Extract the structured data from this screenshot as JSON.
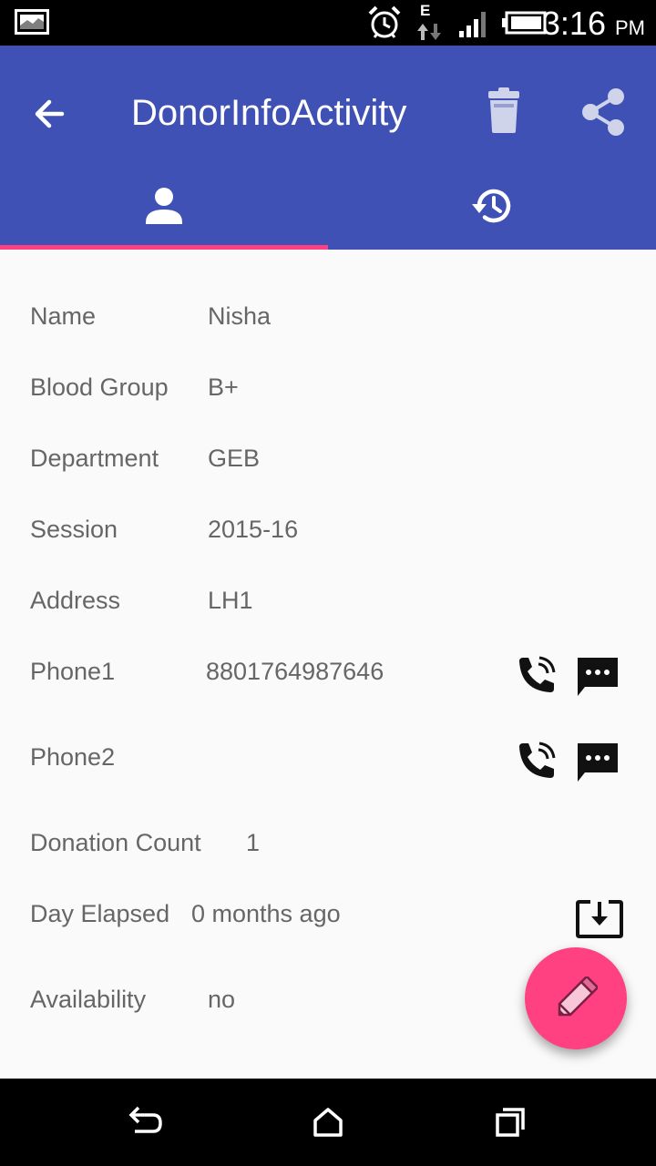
{
  "status_bar": {
    "time": "3:16",
    "ampm": "PM",
    "network_type": "E",
    "icons": [
      "gallery-icon",
      "alarm-icon",
      "data-transfer-icon",
      "signal-icon",
      "battery-icon"
    ]
  },
  "app_bar": {
    "title": "DonorInfoActivity",
    "color": "#3f51b5",
    "actions": [
      "back-arrow-icon",
      "delete-icon",
      "share-icon"
    ],
    "tabs": [
      {
        "icon": "person-icon",
        "selected": true
      },
      {
        "icon": "history-icon",
        "selected": false
      }
    ],
    "indicator_color": "#ff4081"
  },
  "details": {
    "name": {
      "label": "Name",
      "value": "Nisha"
    },
    "blood_group": {
      "label": "Blood Group",
      "value": "B+"
    },
    "department": {
      "label": "Department",
      "value": "GEB"
    },
    "session": {
      "label": "Session",
      "value": "2015-16"
    },
    "address": {
      "label": "Address",
      "value": "LH1"
    },
    "phone1": {
      "label": "Phone1",
      "value": "8801764987646",
      "actions": [
        "phone-call-icon",
        "message-icon"
      ]
    },
    "phone2": {
      "label": "Phone2",
      "value": "",
      "actions": [
        "phone-call-icon",
        "message-icon"
      ]
    },
    "donation_count": {
      "label": "Donation Count",
      "value": "1"
    },
    "day_elapsed": {
      "label": "Day Elapsed",
      "value": "0 months ago",
      "action": "download-icon"
    },
    "availability": {
      "label": "Availability",
      "value": "no"
    }
  },
  "fab": {
    "icon": "pencil-icon",
    "color": "#ff4081"
  },
  "nav_bar": {
    "buttons": [
      "back-icon",
      "home-icon",
      "recents-icon"
    ]
  }
}
